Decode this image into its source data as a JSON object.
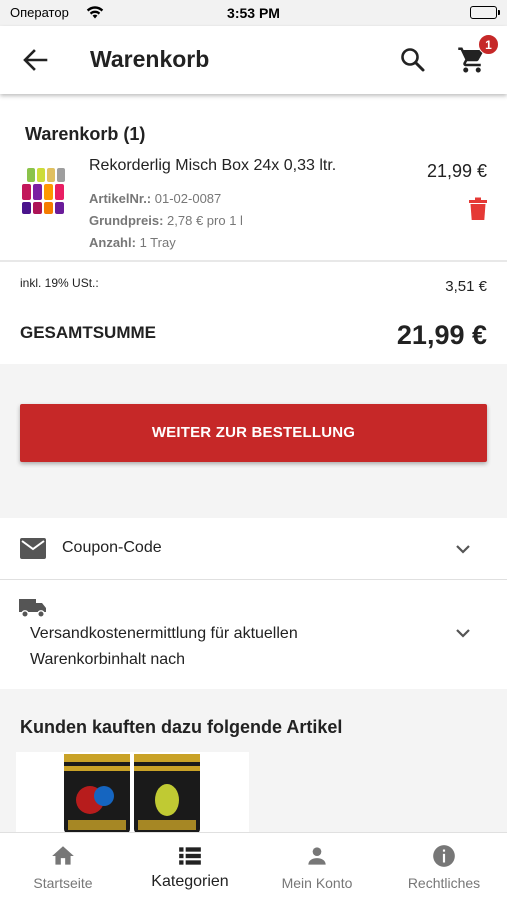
{
  "status_bar": {
    "carrier": "Оператор",
    "time": "3:53 PM"
  },
  "app_bar": {
    "title": "Warenkorb",
    "cart_badge": "1",
    "icons": [
      "back-arrow-icon",
      "search-icon",
      "cart-icon"
    ]
  },
  "cart": {
    "heading": "Warenkorb (1)",
    "items": [
      {
        "name": "Rekorderlig Misch Box 24x 0,33 ltr.",
        "price": "21,99 €",
        "article_label": "ArtikelNr.:",
        "article_value": "01-02-0087",
        "baseprice_label": "Grundpreis:",
        "baseprice_value": "2,78 € pro 1 l",
        "quantity_label": "Anzahl:",
        "quantity_value": "1 Tray"
      }
    ]
  },
  "totals": {
    "vat_label": "inkl. 19% USt.:",
    "vat_value": "3,51 €",
    "sum_label": "GESAMTSUMME",
    "sum_value": "21,99 €"
  },
  "actions": {
    "order_button": "WEITER ZUR BESTELLUNG"
  },
  "accordions": {
    "coupon": "Coupon-Code",
    "shipping_line1": "Versandkostenermittlung für aktuellen",
    "shipping_line2": "Warenkorbinhalt nach"
  },
  "recommendations": {
    "title": "Kunden kauften dazu folgende Artikel"
  },
  "tabbar": {
    "tabs": [
      {
        "label": "Startseite",
        "icon": "home-icon"
      },
      {
        "label": "Kategorien",
        "icon": "list-icon",
        "active": true
      },
      {
        "label": "Mein Konto",
        "icon": "person-icon"
      },
      {
        "label": "Rechtliches",
        "icon": "info-icon"
      }
    ]
  },
  "colors": {
    "accent": "#c62828",
    "background_gray": "#f4f4f4"
  }
}
